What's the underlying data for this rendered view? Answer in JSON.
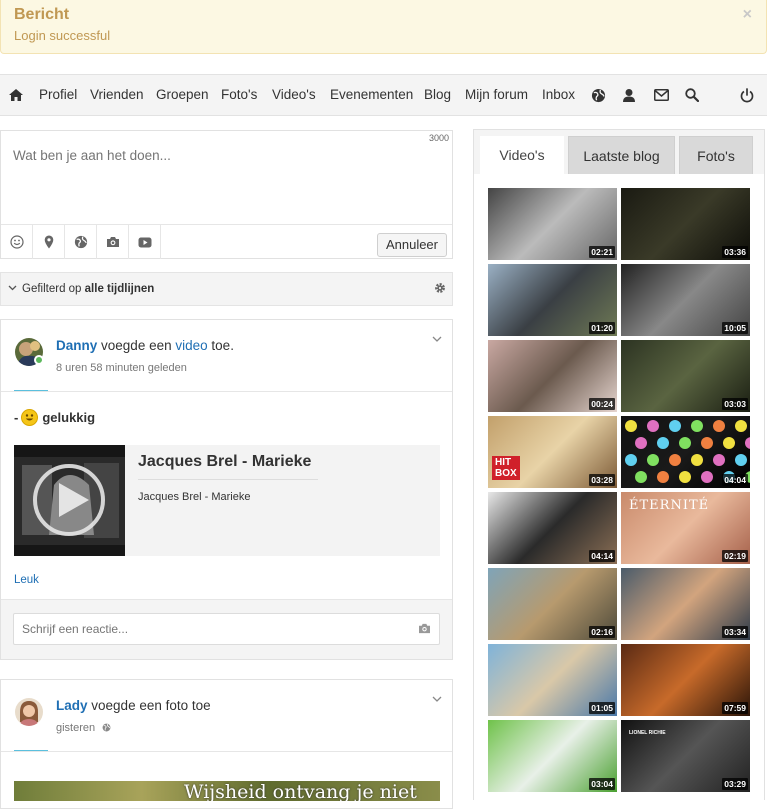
{
  "alert": {
    "title": "Bericht",
    "message": "Login successful",
    "close": "×"
  },
  "nav": {
    "items": [
      "Profiel",
      "Vrienden",
      "Groepen",
      "Foto's",
      "Video's",
      "Evenementen",
      "Blog",
      "Mijn forum",
      "Inbox"
    ],
    "icons": [
      "home-icon",
      "globe-icon",
      "user-icon",
      "envelope-icon",
      "search-icon",
      "power-icon"
    ]
  },
  "composer": {
    "placeholder": "Wat ben je aan het doen...",
    "char_limit": "3000",
    "cancel_label": "Annuleer"
  },
  "filter": {
    "prefix": "Gefilterd op",
    "value": "alle tijdlijnen"
  },
  "posts": [
    {
      "user": "Danny",
      "action_pre": "voegde een",
      "action_link": "video",
      "action_post": "toe.",
      "time": "8 uren 58 minuten geleden",
      "feeling_prefix": "-",
      "feeling": "gelukkig",
      "embed_title": "Jacques Brel - Marieke",
      "embed_desc": "Jacques Brel - Marieke",
      "like": "Leuk",
      "comment_placeholder": "Schrijf een reactie..."
    },
    {
      "user": "Lady",
      "action_pre": "voegde een foto toe",
      "time": "gisteren",
      "photo_text": "Wijsheid ontvang je niet"
    }
  ],
  "side": {
    "tabs": [
      "Video's",
      "Laatste blog",
      "Foto's"
    ],
    "videos": [
      {
        "duration": "02:21",
        "colors": [
          "#444",
          "#bbb",
          "#666"
        ]
      },
      {
        "duration": "03:36",
        "colors": [
          "#1a1a12",
          "#3a3a28",
          "#0d0d08"
        ]
      },
      {
        "duration": "01:20",
        "colors": [
          "#9ab0c4",
          "#3a3f44",
          "#6f7a55"
        ]
      },
      {
        "duration": "10:05",
        "colors": [
          "#222",
          "#888",
          "#444"
        ]
      },
      {
        "duration": "00:24",
        "colors": [
          "#c9a8a2",
          "#6b5a4e",
          "#e6d5cf"
        ]
      },
      {
        "duration": "03:03",
        "colors": [
          "#2c3322",
          "#5a6441",
          "#1a1e12"
        ]
      },
      {
        "duration": "03:28",
        "colors": [
          "#c2a06b",
          "#e8d3a7",
          "#7c5a36"
        ],
        "label": "HIT BOX"
      },
      {
        "duration": "04:04",
        "colors": [
          "#111",
          "#1a1a1a",
          "#000"
        ],
        "smileys": true
      },
      {
        "duration": "04:14",
        "colors": [
          "#e8e8e8",
          "#2a2a2a",
          "#8b6f55"
        ]
      },
      {
        "duration": "02:19",
        "colors": [
          "#c98a6b",
          "#e9b99c",
          "#a5604a"
        ],
        "label": "ÉTERNITÉ"
      },
      {
        "duration": "02:16",
        "colors": [
          "#7fa4b8",
          "#b79a6e",
          "#4e4a3a"
        ]
      },
      {
        "duration": "03:34",
        "colors": [
          "#4a5b6a",
          "#d2a47e",
          "#2e3b4a"
        ]
      },
      {
        "duration": "01:05",
        "colors": [
          "#7fb3d9",
          "#d9c8a8",
          "#4a78a8"
        ]
      },
      {
        "duration": "07:59",
        "colors": [
          "#5a2a14",
          "#c76a2a",
          "#2a1408"
        ]
      },
      {
        "duration": "03:04",
        "colors": [
          "#6fc24a",
          "#e8f0e8",
          "#4aa030"
        ]
      },
      {
        "duration": "03:29",
        "colors": [
          "#111",
          "#555",
          "#222"
        ],
        "label": "LIONEL RICHIE"
      }
    ]
  }
}
